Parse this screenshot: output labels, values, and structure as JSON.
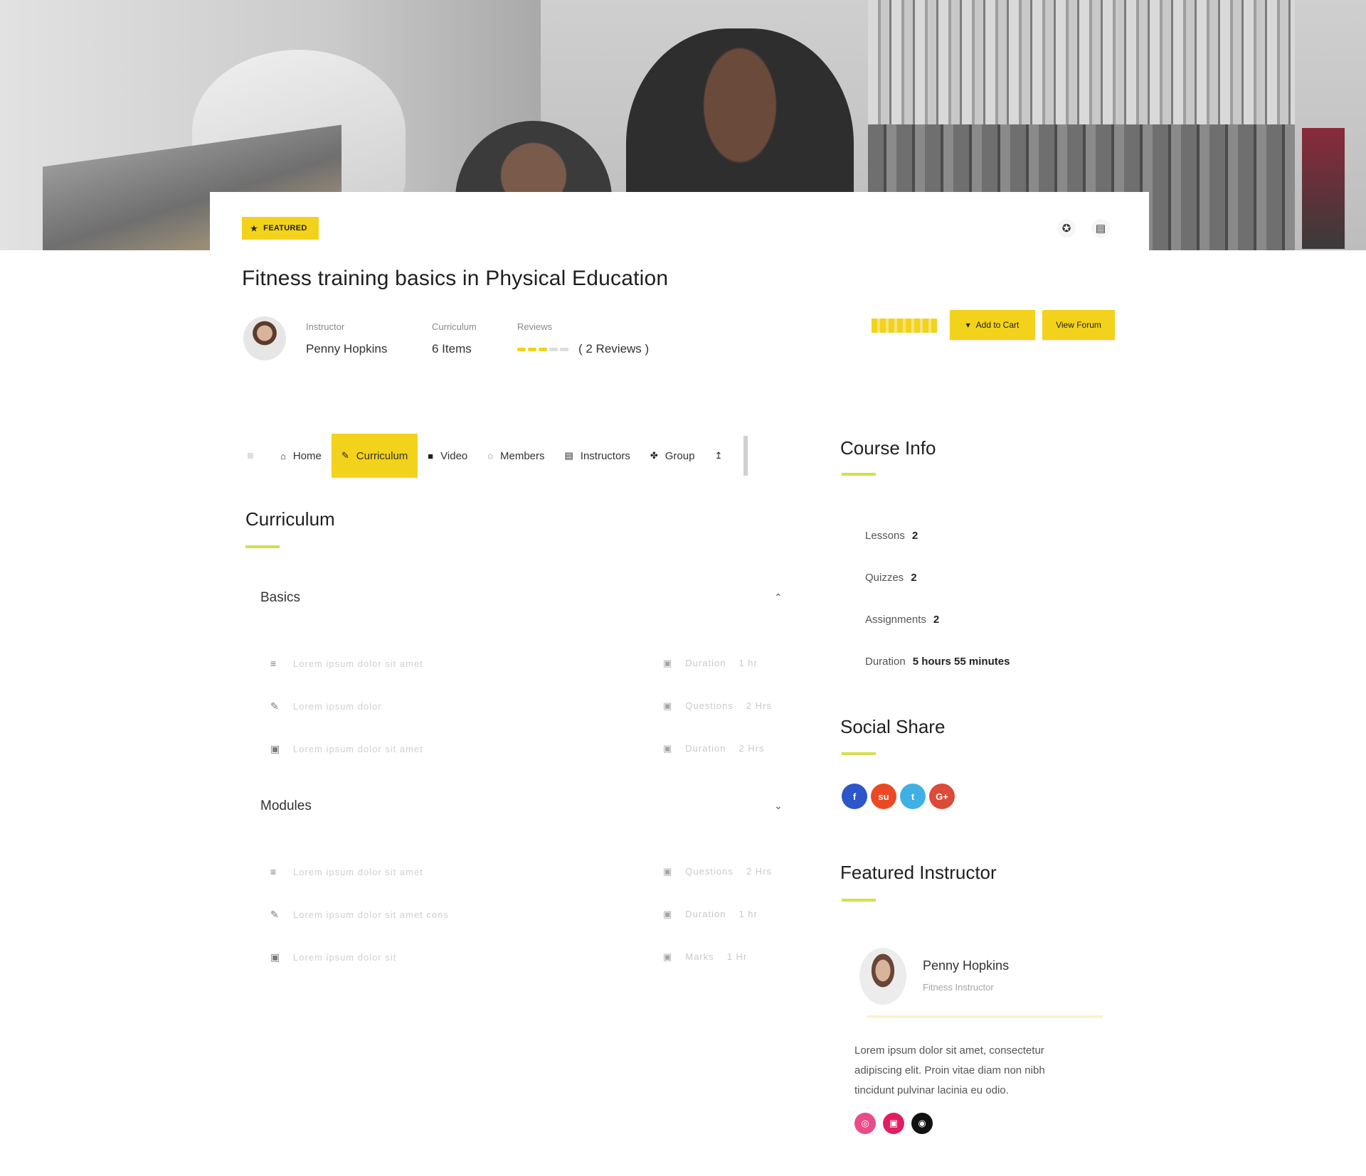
{
  "header": {
    "featured_label": "FEATURED",
    "course_title": "Fitness training basics in Physical Education",
    "instructor_label": "Instructor",
    "instructor_name": "Penny Hopkins",
    "curriculum_label": "Curriculum",
    "curriculum_value": "6 Items",
    "reviews_label": "Reviews",
    "reviews_value": "( 2 Reviews )",
    "rating": 3,
    "rating_max": 5,
    "add_to_cart_label": "Add to Cart",
    "view_forum_label": "View Forum",
    "icons": [
      "award-icon",
      "certificate-icon",
      "cart-icon"
    ]
  },
  "tabs": [
    {
      "icon": "home-icon",
      "glyph": "⌂",
      "label": "Home",
      "active": false
    },
    {
      "icon": "book-icon",
      "glyph": "✎",
      "label": "Curriculum",
      "active": true
    },
    {
      "icon": "video-icon",
      "glyph": "■",
      "label": "Video",
      "active": false
    },
    {
      "icon": "members-icon",
      "glyph": "◌",
      "label": "Members",
      "active": false
    },
    {
      "icon": "instructors-icon",
      "glyph": "▤",
      "label": "Instructors",
      "active": false
    },
    {
      "icon": "group-icon",
      "glyph": "✤",
      "label": "Group",
      "active": false
    },
    {
      "icon": "more-icon",
      "glyph": "↥",
      "label": "",
      "active": false
    }
  ],
  "curriculum": {
    "title": "Curriculum",
    "groups": [
      {
        "title": "Basics",
        "lessons": [
          {
            "icon": "document-icon",
            "glyph": "≡",
            "text": "Lorem ipsum dolor sit amet",
            "meta_icon": "clock-icon",
            "meta": "Duration",
            "time": "1 hr"
          },
          {
            "icon": "quiz-icon",
            "glyph": "✎",
            "text": "Lorem ipsum dolor",
            "meta_icon": "question-icon",
            "meta": "Questions",
            "time": "2 Hrs"
          },
          {
            "icon": "assignment-icon",
            "glyph": "▣",
            "text": "Lorem ipsum dolor sit amet",
            "meta_icon": "marks-icon",
            "meta": "Duration",
            "time": "2 Hrs"
          }
        ]
      },
      {
        "title": "Modules",
        "lessons": [
          {
            "icon": "document-icon",
            "glyph": "≡",
            "text": "Lorem ipsum dolor sit amet",
            "meta_icon": "question-icon",
            "meta": "Questions",
            "time": "2 Hrs"
          },
          {
            "icon": "quiz-icon",
            "glyph": "✎",
            "text": "Lorem ipsum dolor sit amet cons",
            "meta_icon": "clock-icon",
            "meta": "Duration",
            "time": "1 hr"
          },
          {
            "icon": "assignment-icon",
            "glyph": "▣",
            "text": "Lorem ipsum dolor sit",
            "meta_icon": "marks-icon",
            "meta": "Marks",
            "time": "1 Hr"
          }
        ]
      }
    ]
  },
  "course_info": {
    "title": "Course Info",
    "rows": [
      {
        "label": "Lessons",
        "value": "2"
      },
      {
        "label": "Quizzes",
        "value": "2"
      },
      {
        "label": "Assignments",
        "value": "2"
      },
      {
        "label": "Duration",
        "value": "5 hours 55 minutes"
      }
    ]
  },
  "social_share": {
    "title": "Social Share",
    "icons": [
      {
        "name": "facebook-icon",
        "glyph": "f",
        "color": "#2c56c9"
      },
      {
        "name": "stumbleupon-icon",
        "glyph": "su",
        "color": "#eb4924"
      },
      {
        "name": "twitter-icon",
        "glyph": "t",
        "color": "#3fb0e3"
      },
      {
        "name": "google-plus-icon",
        "glyph": "G+",
        "color": "#dc4a38"
      }
    ]
  },
  "featured_instructor": {
    "title": "Featured Instructor",
    "name": "Penny Hopkins",
    "role": "Fitness Instructor",
    "bio": "Lorem ipsum dolor sit amet, consectetur adipiscing elit. Proin vitae diam non nibh tincidunt pulvinar lacinia eu odio.",
    "social": [
      {
        "name": "dribbble-icon",
        "glyph": "◎",
        "color": "#ea4c89"
      },
      {
        "name": "flickr-icon",
        "glyph": "▣",
        "color": "#e11d63"
      },
      {
        "name": "github-icon",
        "glyph": "◉",
        "color": "#111111"
      }
    ]
  },
  "colors": {
    "accent_yellow": "#f3d21b",
    "underline_green": "#d4e04a"
  }
}
